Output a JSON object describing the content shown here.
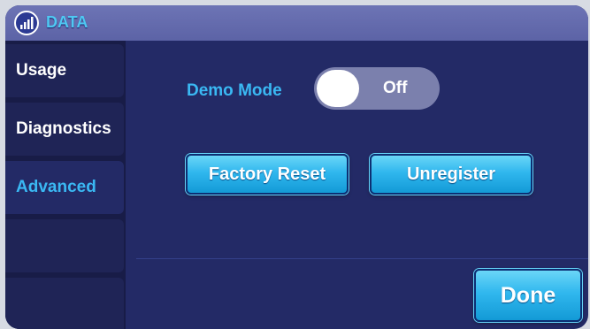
{
  "header": {
    "title": "DATA",
    "icon": "bar-chart-icon"
  },
  "sidebar": {
    "items": [
      {
        "label": "Usage",
        "active": false
      },
      {
        "label": "Diagnostics",
        "active": false
      },
      {
        "label": "Advanced",
        "active": true
      },
      {
        "label": "",
        "active": false
      },
      {
        "label": "",
        "active": false
      }
    ]
  },
  "advanced": {
    "demo_mode": {
      "label": "Demo Mode",
      "state_text": "Off",
      "enabled": false
    },
    "factory_reset_label": "Factory Reset",
    "unregister_label": "Unregister"
  },
  "footer": {
    "done_label": "Done"
  },
  "colors": {
    "accent": "#3ab8f3",
    "panel_bg": "#232a66",
    "titlebar_bg": "#5c63a6",
    "button_bg": "#30b7ee"
  }
}
